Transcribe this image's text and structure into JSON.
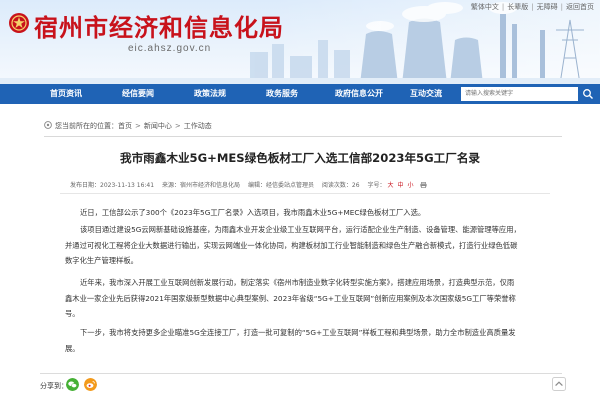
{
  "header": {
    "site_title": "宿州市经济和信息化局",
    "site_domain": "eic.ahsz.gov.cn",
    "top_links": [
      "繁体中文",
      "长辈版",
      "无障碍",
      "返回首页"
    ]
  },
  "nav": {
    "items": [
      "首页资讯",
      "经信要闻",
      "政策法规",
      "政务服务",
      "政府信息公开",
      "互动交流"
    ],
    "search_placeholder": "请输入搜索关键字"
  },
  "breadcrumb": {
    "prefix": "您当前所在的位置：",
    "items": [
      "首页",
      "新闻中心",
      "工作动态"
    ],
    "separator": ">"
  },
  "article": {
    "title": "我市雨鑫木业5G+MES绿色板材工厂入选工信部2023年5G工厂名录",
    "meta": {
      "date": "发布日期：2023-11-13 16:41",
      "source": "来源：宿州市经济和信息化局",
      "editor": "编辑：经信委站点管理员",
      "views": "阅读次数：26",
      "font_label": "字号：",
      "size_large": "大",
      "size_medium": "中",
      "size_small": "小"
    },
    "paragraphs": [
      [
        "近日，工信部公示了300个《2023年5G工厂名录》入选项目，我市雨鑫木业5G+MEC绿色板材工厂入选。"
      ],
      [
        "该项目通过建设5G云网新基础设施基座，为雨鑫木业开发企业级工业互联网平台，运行适配企业生产制造、设备管理、能源管理等应用，",
        "并通过可视化工程将企业大数据进行输出，实现云网端业一体化协同，构建板材加工行业智能制造和绿色生产融合新模式，打造行业绿色低碳",
        "数字化生产管理样板。"
      ],
      [
        "近年来，我市深入开展工业互联网创新发展行动，制定落实《宿州市制造业数字化转型实施方案》，搭建应用场景，打造典型示范，仅雨",
        "鑫木业一家企业先后获得2021年国家级新型数据中心典型案例、2023年省级“5G+工业互联网”创新应用案例及本次国家级5G工厂等荣誉称",
        "号。"
      ],
      [
        "下一步，我市将支持更多企业瞄准5G全连接工厂，打造一批可复制的“5G+工业互联网”样板工程和典型场景，助力全市制造业高质量发",
        "展。"
      ]
    ]
  },
  "share": {
    "label": "分享到："
  },
  "colors": {
    "title_red": "#c8121b",
    "nav_blue": "#1f63b5",
    "wechat_green": "#46b035",
    "weibo_orange": "#f39a1b"
  },
  "icons": [
    "logo-emblem-icon",
    "location-icon",
    "search-icon",
    "print-icon",
    "wechat-icon",
    "weibo-icon",
    "back-to-top-icon"
  ]
}
